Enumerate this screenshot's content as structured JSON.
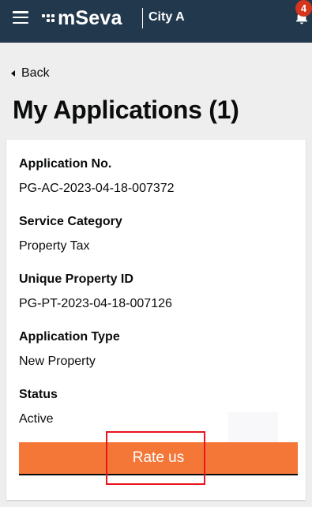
{
  "header": {
    "app_name": "mSeva",
    "city": "City A",
    "notification_count": "4",
    "icons": [
      "hamburger-menu-icon",
      "mseva-logo-icon",
      "bell-icon"
    ]
  },
  "nav": {
    "back_label": "Back"
  },
  "page": {
    "title": "My Applications (1)"
  },
  "application": {
    "fields": [
      {
        "label": "Application No.",
        "value": "PG-AC-2023-04-18-007372"
      },
      {
        "label": "Service Category",
        "value": "Property Tax"
      },
      {
        "label": "Unique Property ID",
        "value": "PG-PT-2023-04-18-007126"
      },
      {
        "label": "Application Type",
        "value": "New Property"
      },
      {
        "label": "Status",
        "value": "Active"
      }
    ],
    "rate_button_label": "Rate us"
  },
  "colors": {
    "header_bg": "#22394d",
    "accent": "#f47738",
    "badge": "#d4351c",
    "highlight": "#e8141e",
    "page_bg": "#eeeeee"
  }
}
